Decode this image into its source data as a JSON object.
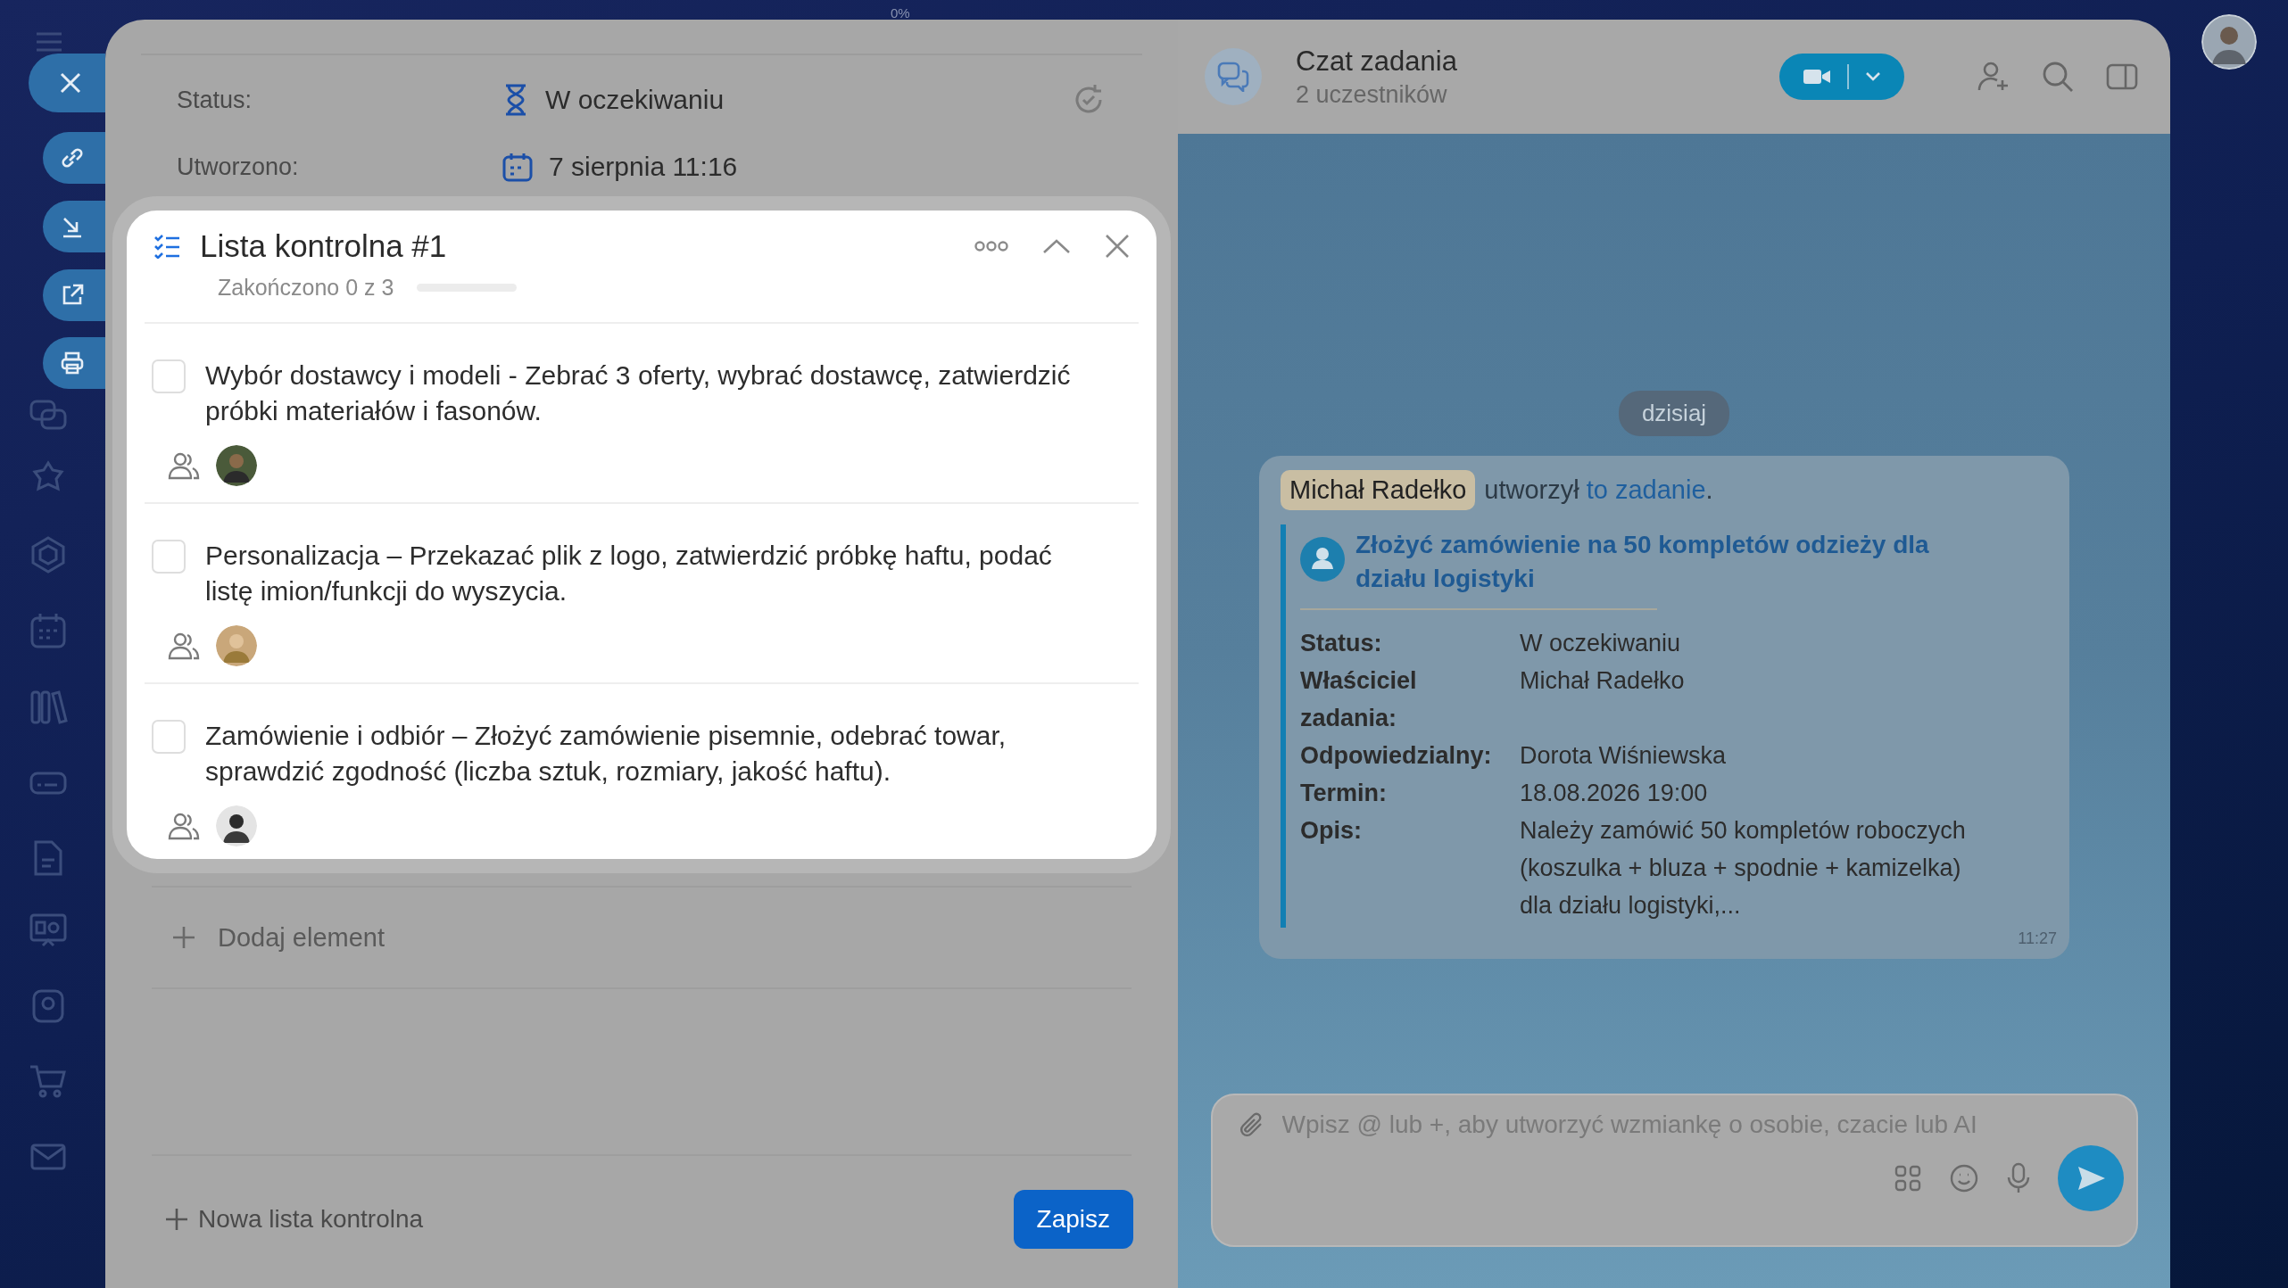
{
  "top_indicator": "0%",
  "task": {
    "status_label": "Status:",
    "status_value": "W oczekiwaniu",
    "created_label": "Utworzono:",
    "created_value": "7 sierpnia 11:16"
  },
  "checklist": {
    "title": "Lista kontrolna #1",
    "progress_text": "Zakończono 0 z 3",
    "progress": {
      "level": 0
    },
    "items": [
      {
        "text": "Wybór dostawcy i modeli - Zebrać 3 oferty, wybrać dostawcę, zatwierdzić próbki materiałów i fasonów.",
        "checked": false
      },
      {
        "text": "Personalizacja – Przekazać plik z logo, zatwierdzić próbkę haftu, podać listę imion/funkcji do wyszycia.",
        "checked": false
      },
      {
        "text": "Zamówienie i odbiór – Złożyć zamówienie pisemnie, odebrać towar, sprawdzić zgodność (liczba sztuk, rozmiary, jakość haftu).",
        "checked": false
      }
    ]
  },
  "add_item": "Dodaj element",
  "new_checklist": "Nowa lista kontrolna",
  "save_button": "Zapisz",
  "chat": {
    "title": "Czat zadania",
    "subtitle": "2 uczestników",
    "date_divider": "dzisiaj",
    "message": {
      "author": "Michał Radełko",
      "text": "utworzył",
      "link": "to zadanie",
      "end": ".",
      "task_title": "Złożyć zamówienie na 50 kompletów odzieży dla działu logistyki",
      "fields": [
        {
          "label": "Status:",
          "value": "W oczekiwaniu"
        },
        {
          "label": "Właściciel zadania:",
          "value": "Michał Radełko"
        },
        {
          "label": "Odpowiedzialny:",
          "value": "Dorota Wiśniewska"
        },
        {
          "label": "Termin:",
          "value": "18.08.2026 19:00"
        },
        {
          "label": "Opis:",
          "value": "Należy zamówić 50 kompletów roboczych (koszulka + bluza + spodnie + kamizelka) dla działu logistyki,..."
        }
      ],
      "time": "11:27"
    },
    "input_placeholder": "Wpisz @ lub +, aby utworzyć wzmiankę o osobie, czacie lub AI"
  }
}
